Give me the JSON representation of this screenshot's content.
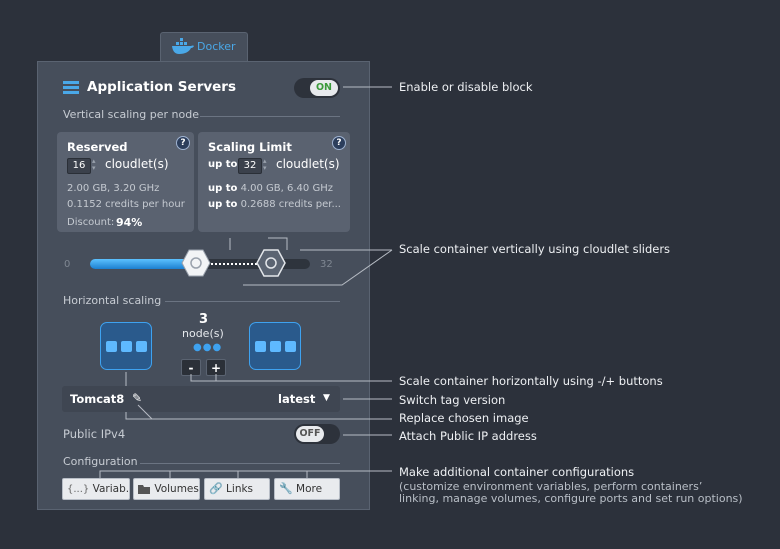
{
  "tab": {
    "label": "Docker",
    "icon": "docker-whale-icon"
  },
  "header": {
    "title": "Application Servers",
    "toggle": "ON"
  },
  "vertical": {
    "section_label": "Vertical scaling per node",
    "reserved": {
      "title": "Reserved",
      "value": "16",
      "unit": "cloudlet(s)",
      "line1": "2.00 GB, 3.20 GHz",
      "line2": "0.1152 credits per hour",
      "discount_label": "Discount:",
      "discount_value": "94%"
    },
    "limit": {
      "title": "Scaling Limit",
      "prefix": "up to",
      "value": "32",
      "unit": "cloudlet(s)",
      "line1_prefix": "up to",
      "line1": "4.00 GB, 6.40 GHz",
      "line2_prefix": "up to",
      "line2": "0.2688 credits per..."
    },
    "help": "?",
    "slider": {
      "min": "0",
      "max": "32",
      "reserved_fraction": 0.5,
      "limit_fraction": 1.0
    }
  },
  "horizontal": {
    "section_label": "Horizontal scaling",
    "count": "3",
    "unit": "node(s)",
    "minus": "-",
    "plus": "+"
  },
  "tag": {
    "image": "Tomcat8",
    "version": "latest"
  },
  "ipv4": {
    "label": "Public IPv4",
    "toggle": "OFF"
  },
  "config": {
    "section_label": "Configuration",
    "buttons": [
      {
        "label": "Variab...",
        "icon": "braces-icon"
      },
      {
        "label": "Volumes",
        "icon": "folder-icon"
      },
      {
        "label": "Links",
        "icon": "link-icon"
      },
      {
        "label": "More",
        "icon": "wrench-icon"
      }
    ]
  },
  "notes": {
    "enable": "Enable or disable block",
    "vertical": "Scale container vertically using cloudlet sliders",
    "horizontal": "Scale container horizontally using -/+ buttons",
    "tag": "Switch tag version",
    "image": "Replace chosen image",
    "ip": "Attach Public IP address",
    "config": "Make additional container configurations",
    "config_sub1": "(customize environment variables, perform containers’",
    "config_sub2": "linking, manage volumes, configure ports and set run options)"
  },
  "colors": {
    "background": "#2c313b",
    "panel": "#464e5b",
    "accent": "#3ea2f0",
    "on_text": "#3a9a3a"
  }
}
